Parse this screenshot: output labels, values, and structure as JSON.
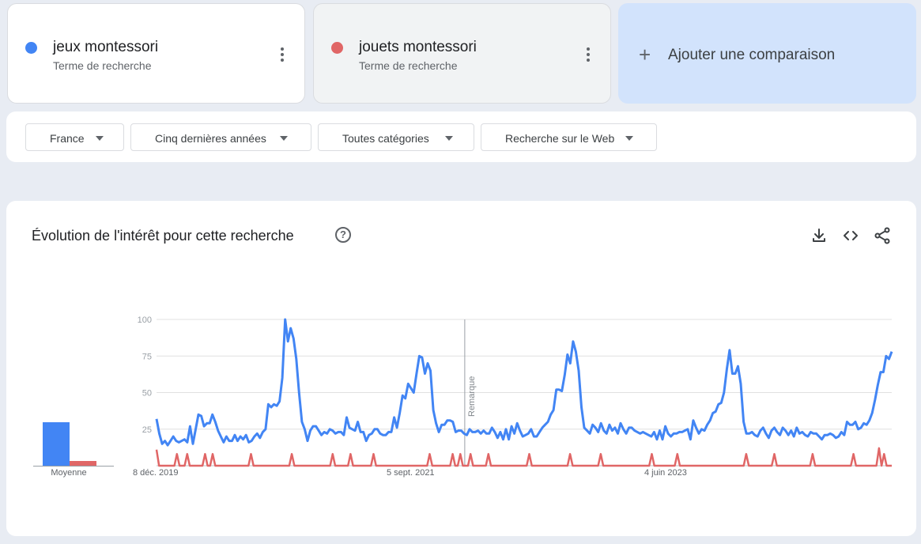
{
  "terms": [
    {
      "name": "jeux montessori",
      "subtitle": "Terme de recherche",
      "color": "#4285f4"
    },
    {
      "name": "jouets montessori",
      "subtitle": "Terme de recherche",
      "color": "#e06666"
    }
  ],
  "add_comparison": {
    "plus": "+",
    "label": "Ajouter une comparaison"
  },
  "filters": {
    "region": "France",
    "period": "Cinq dernières années",
    "category": "Toutes catégories",
    "search_type": "Recherche sur le Web"
  },
  "panel": {
    "title": "Évolution de l'intérêt pour cette recherche",
    "help": "?",
    "note_label": "Remarque",
    "average_label": "Moyenne"
  },
  "icons": [
    "download-icon",
    "embed-code-icon",
    "share-icon",
    "help-icon",
    "more-vert-icon",
    "add-icon",
    "dropdown-caret-icon"
  ],
  "chart_data": {
    "type": "line",
    "ylim": [
      0,
      100
    ],
    "yticks": [
      25,
      50,
      75,
      100
    ],
    "xtick_labels": [
      "8 déc. 2019",
      "5 sept. 2021",
      "4 juin 2023"
    ],
    "x_range": [
      "2019-12-08",
      "2024-12-01"
    ],
    "note_marker": "2022-01-09",
    "averages": [
      {
        "name": "jeux montessori",
        "value": 30
      },
      {
        "name": "jouets montessori",
        "value": 3
      }
    ],
    "series": [
      {
        "name": "jeux montessori",
        "color": "#4285f4",
        "values": [
          32,
          22,
          15,
          17,
          14,
          17,
          20,
          17,
          16,
          17,
          18,
          16,
          27,
          15,
          25,
          35,
          34,
          27,
          29,
          29,
          35,
          30,
          24,
          20,
          16,
          20,
          17,
          17,
          21,
          17,
          20,
          18,
          21,
          16,
          17,
          20,
          22,
          19,
          23,
          25,
          42,
          40,
          42,
          41,
          44,
          60,
          100,
          85,
          94,
          87,
          73,
          50,
          30,
          25,
          17,
          24,
          27,
          27,
          24,
          21,
          23,
          22,
          25,
          24,
          22,
          23,
          23,
          21,
          33,
          26,
          25,
          24,
          30,
          23,
          23,
          17,
          21,
          22,
          25,
          25,
          22,
          21,
          21,
          23,
          23,
          33,
          26,
          36,
          48,
          46,
          56,
          53,
          50,
          63,
          75,
          74,
          63,
          70,
          65,
          38,
          29,
          23,
          28,
          28,
          31,
          31,
          30,
          23,
          24,
          24,
          22,
          21,
          25,
          23,
          23,
          24,
          22,
          24,
          22,
          22,
          26,
          23,
          19,
          23,
          18,
          25,
          18,
          27,
          22,
          29,
          24,
          20,
          21,
          22,
          25,
          20,
          20,
          23,
          26,
          28,
          30,
          35,
          38,
          52,
          52,
          51,
          62,
          76,
          70,
          85,
          78,
          65,
          40,
          26,
          24,
          22,
          28,
          26,
          23,
          29,
          24,
          22,
          28,
          24,
          26,
          22,
          29,
          25,
          22,
          26,
          26,
          24,
          23,
          22,
          23,
          22,
          21,
          20,
          23,
          18,
          24,
          18,
          27,
          22,
          20,
          22,
          22,
          23,
          23,
          24,
          25,
          18,
          31,
          26,
          22,
          25,
          24,
          28,
          31,
          36,
          37,
          42,
          43,
          50,
          66,
          79,
          63,
          63,
          68,
          56,
          30,
          22,
          22,
          23,
          21,
          20,
          24,
          26,
          22,
          19,
          24,
          26,
          23,
          21,
          26,
          24,
          21,
          24,
          20,
          26,
          22,
          23,
          21,
          20,
          23,
          22,
          22,
          20,
          18,
          21,
          21,
          22,
          21,
          19,
          20,
          23,
          21,
          30,
          28,
          28,
          30,
          25,
          26,
          29,
          28,
          31,
          36,
          45,
          55,
          64,
          64,
          75,
          73,
          78
        ]
      },
      {
        "name": "jouets montessori",
        "color": "#e06666",
        "values": [
          11,
          0,
          0,
          0,
          0,
          0,
          0,
          0,
          8,
          0,
          0,
          0,
          8,
          0,
          0,
          0,
          0,
          0,
          0,
          8,
          0,
          0,
          8,
          0,
          0,
          0,
          0,
          0,
          0,
          0,
          0,
          0,
          0,
          0,
          0,
          0,
          0,
          8,
          0,
          0,
          0,
          0,
          0,
          0,
          0,
          0,
          0,
          0,
          0,
          0,
          0,
          0,
          0,
          8,
          0,
          0,
          0,
          0,
          0,
          0,
          0,
          0,
          0,
          0,
          0,
          0,
          0,
          0,
          0,
          8,
          0,
          0,
          0,
          0,
          0,
          0,
          8,
          0,
          0,
          0,
          0,
          0,
          0,
          0,
          0,
          8,
          0,
          0,
          0,
          0,
          0,
          0,
          0,
          0,
          0,
          0,
          0,
          0,
          0,
          0,
          0,
          0,
          0,
          0,
          0,
          0,
          0,
          8,
          0,
          0,
          0,
          0,
          0,
          0,
          0,
          0,
          8,
          0,
          0,
          8,
          0,
          0,
          0,
          8,
          0,
          0,
          0,
          0,
          0,
          0,
          8,
          0,
          0,
          0,
          0,
          0,
          0,
          0,
          0,
          0,
          0,
          0,
          0,
          0,
          0,
          0,
          8,
          0,
          0,
          0,
          0,
          0,
          0,
          0,
          0,
          0,
          0,
          0,
          0,
          0,
          0,
          0,
          8,
          0,
          0,
          0,
          0,
          0,
          0,
          0,
          0,
          0,
          0,
          0,
          8,
          0,
          0,
          0,
          0,
          0,
          0,
          0,
          0,
          0,
          0,
          0,
          0,
          0,
          0,
          0,
          0,
          0,
          0,
          0,
          8,
          0,
          0,
          0,
          0,
          0,
          0,
          0,
          0,
          0,
          8,
          0,
          0,
          0,
          0,
          0,
          0,
          0,
          0,
          0,
          0,
          0,
          0,
          0,
          0,
          0,
          0,
          0,
          0,
          0,
          0,
          0,
          0,
          0,
          0,
          0,
          0,
          8,
          0,
          0,
          0,
          0,
          0,
          0,
          0,
          0,
          0,
          0,
          8,
          0,
          0,
          0,
          0,
          0,
          0,
          0,
          0,
          0,
          0,
          0,
          0,
          0,
          0,
          8,
          0,
          0,
          0,
          0,
          0,
          0,
          0,
          0,
          0,
          0,
          0,
          0,
          0,
          0,
          0,
          8,
          0,
          0,
          0,
          0,
          0,
          0,
          0,
          0,
          0,
          12,
          0,
          8,
          0,
          0,
          0
        ]
      }
    ]
  }
}
